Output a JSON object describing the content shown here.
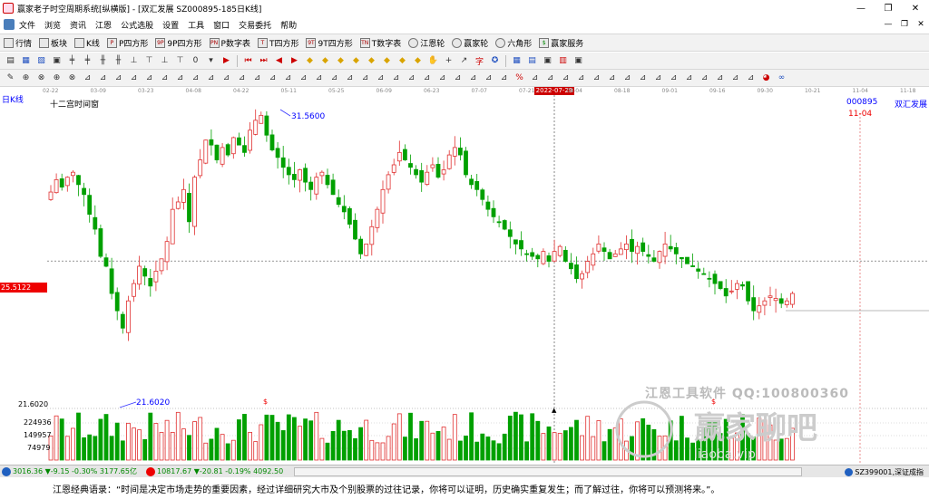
{
  "window": {
    "title": "赢家老子时空周期系统[纵横版] - [双汇发展  SZ000895-185日K线]",
    "controls": [
      "—",
      "❐",
      "✕"
    ]
  },
  "menubar": {
    "items": [
      "文件",
      "浏览",
      "资讯",
      "江恩",
      "公式选股",
      "设置",
      "工具",
      "窗口",
      "交易委托",
      "帮助"
    ],
    "right": [
      "—",
      "❐",
      "✕"
    ]
  },
  "toolbar1": {
    "items": [
      {
        "label": "行情",
        "icon": "grid-icon"
      },
      {
        "label": "板块",
        "icon": "blocks-icon"
      },
      {
        "label": "K线",
        "icon": "kline-icon"
      },
      {
        "label": "P四方形",
        "icon": "p-square-icon"
      },
      {
        "label": "9P四方形",
        "icon": "9p-square-icon"
      },
      {
        "label": "P数字表",
        "icon": "p-number-icon"
      },
      {
        "label": "T四方形",
        "icon": "t-square-icon"
      },
      {
        "label": "9T四方形",
        "icon": "9t-square-icon"
      },
      {
        "label": "T数字表",
        "icon": "t-number-icon"
      },
      {
        "label": "江恩轮",
        "icon": "gann-wheel-icon"
      },
      {
        "label": "赢家轮",
        "icon": "winner-wheel-icon"
      },
      {
        "label": "六角形",
        "icon": "hexagon-icon"
      },
      {
        "label": "赢家服务",
        "icon": "dollar-icon"
      }
    ]
  },
  "toolbar2": {
    "period_value": "0"
  },
  "datebar": {
    "ticks": [
      "02-22",
      "03-09",
      "03-23",
      "04-08",
      "04-22",
      "05-11",
      "05-25",
      "06-09",
      "06-23",
      "07-07",
      "07-21",
      "08-04",
      "08-18",
      "09-01",
      "09-16",
      "09-30",
      "10-21",
      "11-04",
      "11-18"
    ],
    "highlight": "2022-07-29"
  },
  "chart": {
    "period_label": "日K线",
    "window_label": "十二宫时间窗",
    "stock_code": "000895",
    "stock_name": "双汇发展",
    "date_marker": "11-04",
    "high_label": "31.5600",
    "low_label": "21.6020",
    "price_tag": "25.5122",
    "vol_axis": [
      "21.6020",
      "224936",
      "149957",
      "74979"
    ],
    "colors": {
      "up": "#e03030",
      "down": "#00a000",
      "tag": "#e00000"
    }
  },
  "chart_data": {
    "type": "candlestick",
    "symbol": "SZ000895",
    "period": "185日K线",
    "high": 31.56,
    "low": 21.602,
    "crosshair_price": 25.5122,
    "candles_close": [
      28.3,
      28.8,
      28.5,
      28.9,
      29.1,
      28.6,
      28.2,
      27.4,
      26.8,
      25.7,
      25.3,
      24.2,
      23.5,
      22.8,
      23.9,
      24.6,
      25.3,
      24.9,
      24.5,
      25.1,
      25.6,
      26.3,
      27.6,
      27.9,
      28.4,
      27.1,
      28.9,
      29.6,
      30.4,
      30.2,
      29.6,
      30.1,
      29.8,
      30.5,
      30.2,
      29.9,
      30.8,
      31.2,
      31.4,
      30.6,
      30.0,
      29.7,
      29.3,
      29.0,
      28.8,
      29.2,
      28.7,
      28.4,
      28.9,
      29.1,
      28.6,
      28.2,
      27.8,
      27.5,
      27.0,
      26.4,
      25.8,
      26.2,
      26.9,
      27.6,
      28.4,
      29.0,
      29.4,
      29.9,
      29.6,
      29.3,
      29.0,
      28.7,
      29.1,
      29.4,
      28.9,
      29.2,
      29.8,
      30.1,
      29.8,
      29.0,
      28.6,
      28.4,
      28.0,
      27.6,
      27.3,
      27.1,
      26.8,
      26.5,
      26.2,
      26.0,
      25.8,
      25.7,
      25.6,
      25.9,
      25.5,
      25.9,
      26.1,
      25.5,
      25.2,
      24.8,
      25.0,
      25.5,
      25.8,
      26.2,
      25.9,
      25.6,
      25.8,
      26.0,
      26.2,
      25.9,
      26.1,
      25.9,
      25.7,
      25.5,
      25.9,
      26.2,
      26.0,
      25.8,
      25.6,
      25.4,
      25.3,
      25.1,
      25.0,
      24.8,
      24.6,
      24.4,
      24.1,
      24.3,
      24.6,
      24.5,
      23.9,
      23.5,
      23.7,
      23.9,
      24.1,
      24.0,
      23.8,
      23.9,
      24.2
    ]
  },
  "statusbar": {
    "sh_index": "3016.36",
    "sh_change": "▼-9.15",
    "sh_pct": "-0.30%",
    "sh_amount": "3177.65亿",
    "sz_index": "10817.67",
    "sz_change": "▼-20.81",
    "sz_pct": "-0.19%",
    "sz_amount": "4092.50",
    "right_label": "SZ399001,深证成指"
  },
  "quotebar": {
    "text": "江恩经典语录：“时间是决定市场走势的重要因素，经过详细研究大市及个别股票的过往记录，你将可以证明，历史确实重复发生；而了解过往，你将可以预测将来。”。"
  },
  "watermark": {
    "line1": "江恩工具软件  QQ:100800360",
    "brand": "赢家聊吧",
    "site": "liaoba.vip"
  }
}
